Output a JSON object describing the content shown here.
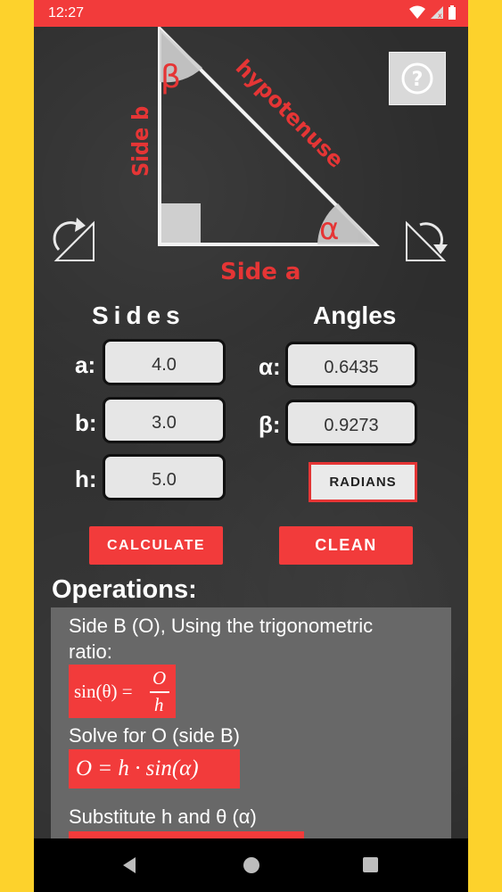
{
  "status_bar": {
    "time": "12:27"
  },
  "diagram": {
    "label_side_b": "Side b",
    "label_hypotenuse": "hypotenuse",
    "label_side_a": "Side a",
    "label_beta": "β",
    "label_alpha": "α",
    "help_icon": "question-circle-icon",
    "rotate_left_icon": "rotate-left-icon",
    "rotate_right_icon": "rotate-right-icon"
  },
  "sides": {
    "heading": "Sides",
    "a_label": "a:",
    "a_value": "4.0",
    "b_label": "b:",
    "b_value": "3.0",
    "h_label": "h:",
    "h_value": "5.0"
  },
  "angles": {
    "heading": "Angles",
    "alpha_label": "α:",
    "alpha_value": "0.6435",
    "beta_label": "β:",
    "beta_value": "0.9273",
    "unit_button": "RADIANS"
  },
  "actions": {
    "calculate": "CALCULATE",
    "clean": "CLEAN"
  },
  "operations": {
    "heading": "Operations:",
    "step1_line1": "Side B (O), Using the trigonometric",
    "step1_line2": "ratio:",
    "formula1_lhs": "sin(θ) =",
    "formula1_num": "O",
    "formula1_den": "h",
    "step2": "Solve for O (side B)",
    "formula2": "O = h · sin(α)",
    "step3": "Substitute h and θ (α)"
  },
  "colors": {
    "accent": "#F23B3B",
    "frame": "#FDD22C",
    "field_bg": "#E6E6E6",
    "panel": "#686868"
  }
}
